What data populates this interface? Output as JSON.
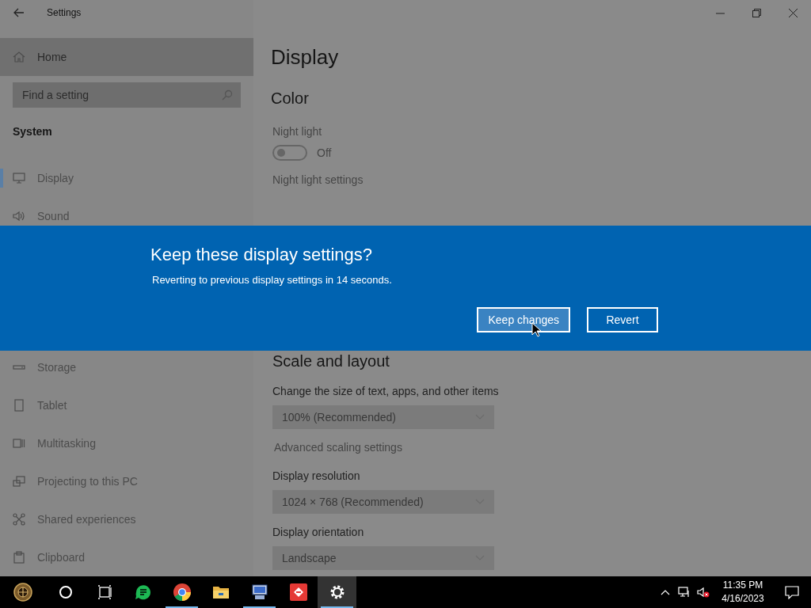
{
  "window": {
    "title": "Settings"
  },
  "sidebar": {
    "home": "Home",
    "search": {
      "placeholder": "Find a setting"
    },
    "section": "System",
    "items_top": [
      {
        "label": "Display",
        "selected": true
      },
      {
        "label": "Sound",
        "selected": false
      }
    ],
    "items_bottom": [
      {
        "label": "Storage",
        "selected": false
      },
      {
        "label": "Tablet",
        "selected": false
      },
      {
        "label": "Multitasking",
        "selected": false
      },
      {
        "label": "Projecting to this PC",
        "selected": false
      },
      {
        "label": "Shared experiences",
        "selected": false
      },
      {
        "label": "Clipboard",
        "selected": false
      }
    ]
  },
  "content": {
    "title": "Display",
    "color_heading": "Color",
    "night_light": {
      "label": "Night light",
      "on": false,
      "state_text": "Off",
      "link": "Night light settings"
    },
    "scale_heading": "Scale and layout",
    "scale": {
      "label": "Change the size of text, apps, and other items",
      "value": "100% (Recommended)"
    },
    "advanced_link": "Advanced scaling settings",
    "resolution": {
      "label": "Display resolution",
      "value": "1024 × 768 (Recommended)"
    },
    "orientation": {
      "label": "Display orientation",
      "value": "Landscape"
    }
  },
  "dialog": {
    "title": "Keep these display settings?",
    "message": "Reverting to previous display settings in 14 seconds.",
    "buttons": [
      {
        "label": "Keep changes",
        "hovered": true
      },
      {
        "label": "Revert",
        "hovered": false
      }
    ]
  },
  "taskbar": {
    "pinned_apps": [
      {
        "running": false,
        "active": false
      },
      {
        "running": true,
        "active": false
      },
      {
        "running": false,
        "active": false
      },
      {
        "running": true,
        "active": false
      },
      {
        "running": false,
        "active": false
      },
      {
        "running": true,
        "active": true
      }
    ],
    "clock": {
      "time": "11:35 PM",
      "date": "4/16/2023"
    }
  }
}
